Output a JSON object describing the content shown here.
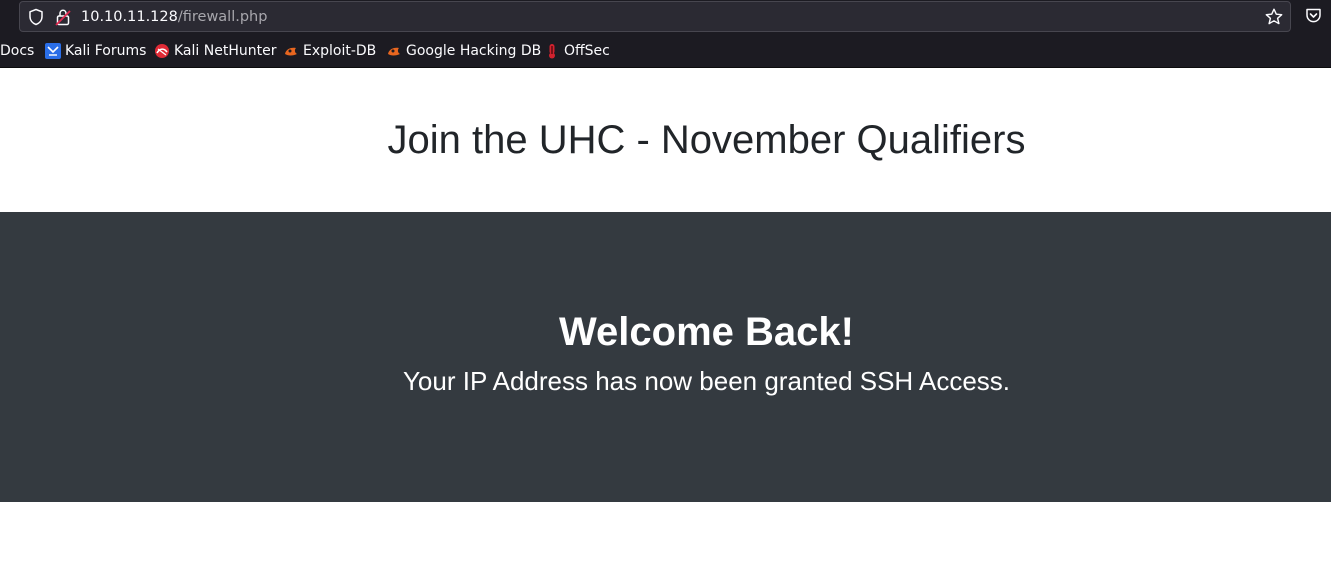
{
  "browser": {
    "url_host": "10.10.11.128",
    "url_path": "/firewall.php",
    "bookmarks": [
      {
        "label": "Docs",
        "icon": "none"
      },
      {
        "label": "Kali Forums",
        "icon": "kali-forums-icon"
      },
      {
        "label": "Kali NetHunter",
        "icon": "kali-nethunter-icon"
      },
      {
        "label": "Exploit-DB",
        "icon": "exploit-db-icon"
      },
      {
        "label": "Google Hacking DB",
        "icon": "google-hacking-db-icon"
      },
      {
        "label": "OffSec",
        "icon": "offsec-icon"
      }
    ]
  },
  "page": {
    "title": "Join the UHC - November Qualifiers",
    "hero": {
      "heading": "Welcome Back!",
      "text": "Your IP Address has now been granted SSH Access."
    }
  },
  "colors": {
    "chrome_bg": "#1c1b22",
    "urlbar_bg": "#2b2a33",
    "hero_bg": "#343a40",
    "title_text": "#212529",
    "hero_text": "#ffffff"
  }
}
